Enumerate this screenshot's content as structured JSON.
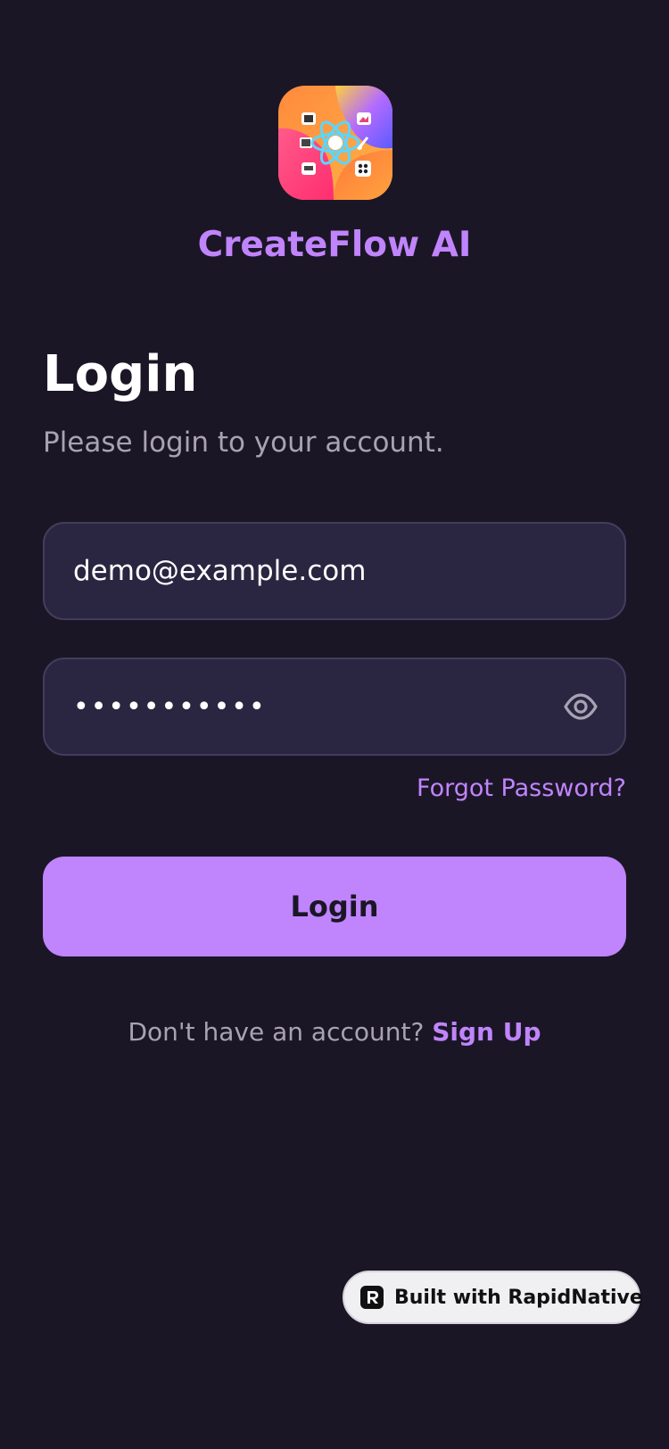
{
  "app": {
    "name": "CreateFlow AI",
    "logo_icon": "app-logo-icon"
  },
  "login": {
    "title": "Login",
    "subtitle": "Please login to your account.",
    "email_value": "demo@example.com",
    "password_value": "•••••••••••",
    "show_password_icon": "eye-icon",
    "forgot_label": "Forgot Password?",
    "submit_label": "Login",
    "signup_prompt": "Don't have an account?",
    "signup_label": "Sign Up"
  },
  "badge": {
    "label": "Built with RapidNative",
    "icon": "rapidnative-icon"
  },
  "colors": {
    "background": "#1b1626",
    "accent": "#c084fc",
    "field_bg": "#2a2540",
    "field_border": "#433d5c",
    "muted_text": "#a8a3b3"
  }
}
